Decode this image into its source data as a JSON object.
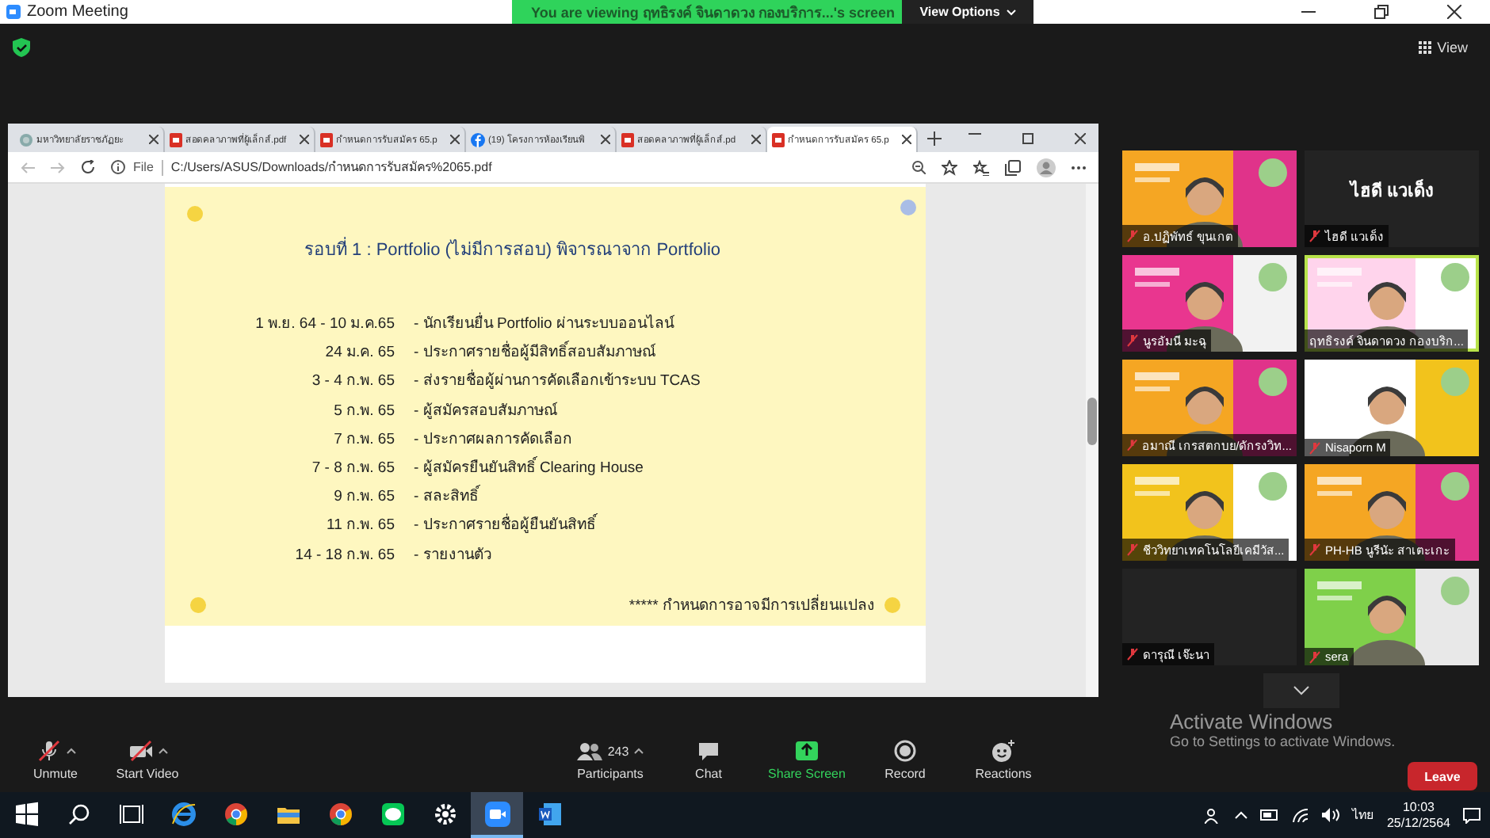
{
  "window": {
    "title": "Zoom Meeting"
  },
  "banner": {
    "text": "You are viewing ฤทธิรงค์ จินดาดวง กองบริการ...'s screen",
    "button": "View Options"
  },
  "view_button": "View",
  "browser": {
    "tabs": [
      {
        "label": "มหาวิทยาลัยราชภัฏยะ",
        "kind": "globe",
        "selected": false
      },
      {
        "label": "สอดคลาภาพที่ผู้เล็กส์.pdf",
        "kind": "pdf",
        "selected": false
      },
      {
        "label": "กำหนดการรับสมัคร 65.p",
        "kind": "pdf",
        "selected": false
      },
      {
        "label": "(19) โครงการห้องเรียนพิ",
        "kind": "facebook",
        "selected": false
      },
      {
        "label": "สอดคลาภาพที่ผู้เล็กส์.pd",
        "kind": "pdf",
        "selected": false
      },
      {
        "label": "กำหนดการรับสมัคร 65.p",
        "kind": "pdf",
        "selected": true
      }
    ],
    "address": {
      "scheme": "File",
      "path": "C:/Users/ASUS/Downloads/กำหนดการรับสมัคร%2065.pdf"
    }
  },
  "document": {
    "title": "รอบที่ 1 : Portfolio (ไม่มีการสอบ)  พิจารณาจาก Portfolio",
    "schedule": [
      {
        "date": "1 พ.ย. 64 - 10 ม.ค.65",
        "activity": "- นักเรียนยื่น Portfolio ผ่านระบบออนไลน์"
      },
      {
        "date": "24 ม.ค. 65",
        "activity": "- ประกาศรายชื่อผู้มีสิทธิ์สอบสัมภาษณ์"
      },
      {
        "date": "3 - 4 ก.พ. 65",
        "activity": "- ส่งรายชื่อผู้ผ่านการคัดเลือกเข้าระบบ TCAS"
      },
      {
        "date": "5 ก.พ. 65",
        "activity": "- ผู้สมัครสอบสัมภาษณ์"
      },
      {
        "date": "7 ก.พ. 65",
        "activity": "- ประกาศผลการคัดเลือก"
      },
      {
        "date": "7 - 8 ก.พ. 65",
        "activity": "- ผู้สมัครยืนยันสิทธิ์ Clearing House"
      },
      {
        "date": "9 ก.พ. 65",
        "activity": "- สละสิทธิ์"
      },
      {
        "date": "11 ก.พ. 65",
        "activity": "- ประกาศรายชื่อผู้ยืนยันสิทธิ์"
      },
      {
        "date": "14 - 18 ก.พ. 65",
        "activity": "- รายงานตัว"
      }
    ],
    "note": "***** กำหนดการอาจมีการเปลี่ยนแปลง"
  },
  "participants": [
    {
      "name": "อ.ปฏิพัทธ์ ขุนเกต",
      "kind": "video",
      "muted": true,
      "speaking": false
    },
    {
      "name": "ไฮดี แวเด็ง",
      "display_name": "ไฮดี แวเด็ง",
      "kind": "name",
      "muted": true,
      "speaking": false
    },
    {
      "name": "นูรอัมนี มะฉุ",
      "kind": "video",
      "muted": true,
      "speaking": false
    },
    {
      "name": "ฤทธิรงค์ จินดาดวง กองบริก...",
      "kind": "video",
      "muted": false,
      "speaking": true
    },
    {
      "name": "อมาณี เกรสตกบย/ดักรงวิท...",
      "kind": "video",
      "muted": true,
      "speaking": false
    },
    {
      "name": "Nisaporn M",
      "kind": "video",
      "muted": true,
      "speaking": false
    },
    {
      "name": "ชีววิทยาเทคโนโลยีเคมีวัส...",
      "kind": "video",
      "muted": true,
      "speaking": false
    },
    {
      "name": "PH-HB นูรีนัะ สาเตะเกะ",
      "kind": "video",
      "muted": true,
      "speaking": false
    },
    {
      "name": "ดารุณี เจ๊ะนา",
      "kind": "blank",
      "muted": true,
      "speaking": false
    },
    {
      "name": "sera",
      "kind": "video",
      "muted": true,
      "speaking": false
    }
  ],
  "toolbar": [
    {
      "label": "Unmute",
      "kind": "mic",
      "menu": true
    },
    {
      "label": "Start Video",
      "kind": "video",
      "menu": true
    },
    {
      "label": "Participants",
      "kind": "participants",
      "count": "243",
      "menu": true
    },
    {
      "label": "Chat",
      "kind": "chat",
      "menu": false
    },
    {
      "label": "Share Screen",
      "kind": "share",
      "menu": false
    },
    {
      "label": "Record",
      "kind": "record",
      "menu": false
    },
    {
      "label": "Reactions",
      "kind": "reactions",
      "menu": false
    }
  ],
  "leave": "Leave",
  "activation": {
    "title": "Activate Windows",
    "text": "Go to Settings to activate Windows."
  },
  "taskbar": {
    "apps": [
      {
        "kind": "start",
        "active": false
      },
      {
        "kind": "search",
        "active": false
      },
      {
        "kind": "taskview",
        "active": false
      },
      {
        "kind": "ie",
        "active": false
      },
      {
        "kind": "chrome",
        "active": false
      },
      {
        "kind": "explorer",
        "active": false
      },
      {
        "kind": "chrome",
        "active": false
      },
      {
        "kind": "line",
        "active": false
      },
      {
        "kind": "settings",
        "active": false
      },
      {
        "kind": "zoom",
        "active": true
      },
      {
        "kind": "word",
        "active": false
      }
    ],
    "language": "ไทย",
    "time": "10:03",
    "date": "25/12/2564"
  }
}
